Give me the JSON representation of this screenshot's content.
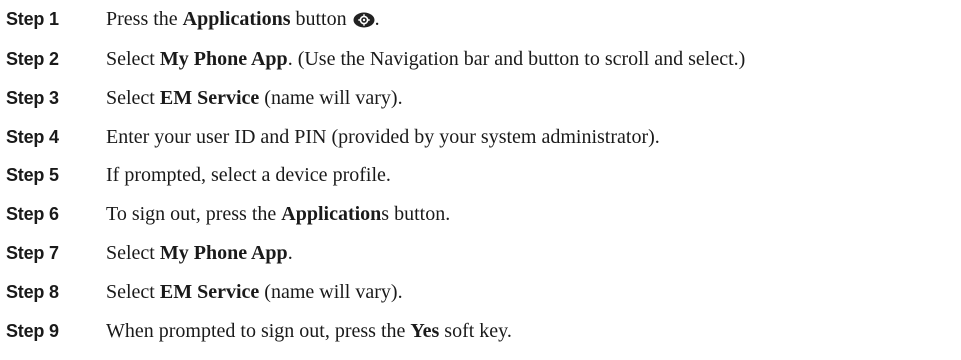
{
  "steps": [
    {
      "label": "Step 1",
      "parts": [
        {
          "text": "Press the ",
          "bold": false
        },
        {
          "text": "Applications",
          "bold": true
        },
        {
          "text": " button",
          "bold": false
        },
        {
          "icon": "applications-button-icon"
        },
        {
          "text": ".",
          "bold": false
        }
      ]
    },
    {
      "label": "Step 2",
      "parts": [
        {
          "text": "Select ",
          "bold": false
        },
        {
          "text": "My Phone App",
          "bold": true
        },
        {
          "text": ". (Use the Navigation bar and button to scroll and select.)",
          "bold": false
        }
      ]
    },
    {
      "label": "Step 3",
      "parts": [
        {
          "text": "Select ",
          "bold": false
        },
        {
          "text": "EM Service",
          "bold": true
        },
        {
          "text": " (name will vary).",
          "bold": false
        }
      ]
    },
    {
      "label": "Step 4",
      "parts": [
        {
          "text": "Enter your user ID and PIN (provided by your system administrator).",
          "bold": false
        }
      ]
    },
    {
      "label": "Step 5",
      "parts": [
        {
          "text": "If prompted, select a device profile.",
          "bold": false
        }
      ]
    },
    {
      "label": "Step 6",
      "parts": [
        {
          "text": "To sign out, press the ",
          "bold": false
        },
        {
          "text": "Application",
          "bold": true
        },
        {
          "text": "s button.",
          "bold": false
        }
      ]
    },
    {
      "label": "Step 7",
      "parts": [
        {
          "text": "Select ",
          "bold": false
        },
        {
          "text": "My Phone App",
          "bold": true
        },
        {
          "text": ".",
          "bold": false
        }
      ]
    },
    {
      "label": "Step 8",
      "parts": [
        {
          "text": "Select ",
          "bold": false
        },
        {
          "text": "EM Service",
          "bold": true
        },
        {
          "text": " (name will vary).",
          "bold": false
        }
      ]
    },
    {
      "label": "Step 9",
      "parts": [
        {
          "text": "When prompted to sign out, press the ",
          "bold": false
        },
        {
          "text": "Yes",
          "bold": true
        },
        {
          "text": " soft key.",
          "bold": false
        }
      ]
    }
  ]
}
